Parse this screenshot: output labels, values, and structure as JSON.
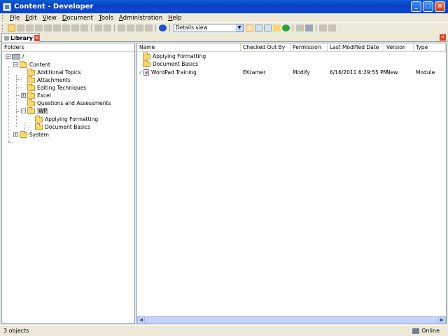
{
  "window": {
    "title": "Content - Developer",
    "buttons": {
      "minimize": "_",
      "maximize": "□",
      "close": "×"
    }
  },
  "menubar": {
    "items": [
      {
        "accel": "F",
        "rest": "ile"
      },
      {
        "accel": "E",
        "rest": "dit"
      },
      {
        "accel": "V",
        "rest": "iew"
      },
      {
        "accel": "D",
        "rest": "ocument"
      },
      {
        "accel": "T",
        "rest": "ools"
      },
      {
        "accel": "A",
        "rest": "dministration"
      },
      {
        "accel": "H",
        "rest": "elp"
      }
    ]
  },
  "toolbar": {
    "view_select": "Details view",
    "colors": {
      "folder": "#f8d775",
      "refresh": "#2ea043",
      "active_toggle": "#f3a44a"
    }
  },
  "tab": {
    "label": "Library",
    "close": "×"
  },
  "left_pane": {
    "header": "Folders",
    "tree": {
      "root": "/",
      "content": "Content",
      "children": [
        "Additional Topics",
        "Attachments",
        "Editing Techniques",
        "Excel",
        "Questions and Assessments",
        "WP"
      ],
      "wp_children": [
        "Applying Formatting",
        "Document Basics"
      ],
      "system": "System"
    },
    "expanders": {
      "open": "−",
      "closed": "+"
    }
  },
  "right_pane": {
    "columns": [
      "Name",
      "Checked Out By",
      "Permission",
      "Last Modified Date",
      "Version",
      "Type"
    ],
    "rows": [
      {
        "name": "Applying Formatting",
        "checked_out_by": "",
        "permission": "",
        "modified": "",
        "version": "",
        "type": "",
        "icon": "folder-icon"
      },
      {
        "name": "Document Basics",
        "checked_out_by": "",
        "permission": "",
        "modified": "",
        "version": "",
        "type": "",
        "icon": "folder-icon"
      },
      {
        "name": "WordPad Training",
        "checked_out_by": "EKramer",
        "permission": "Modify",
        "modified": "6/16/2011 6:29:55 PM",
        "version": "New",
        "type": "Module",
        "icon": "module-icon",
        "checked_out": "✓"
      }
    ]
  },
  "statusbar": {
    "left": "3 objects",
    "right": "Online"
  }
}
